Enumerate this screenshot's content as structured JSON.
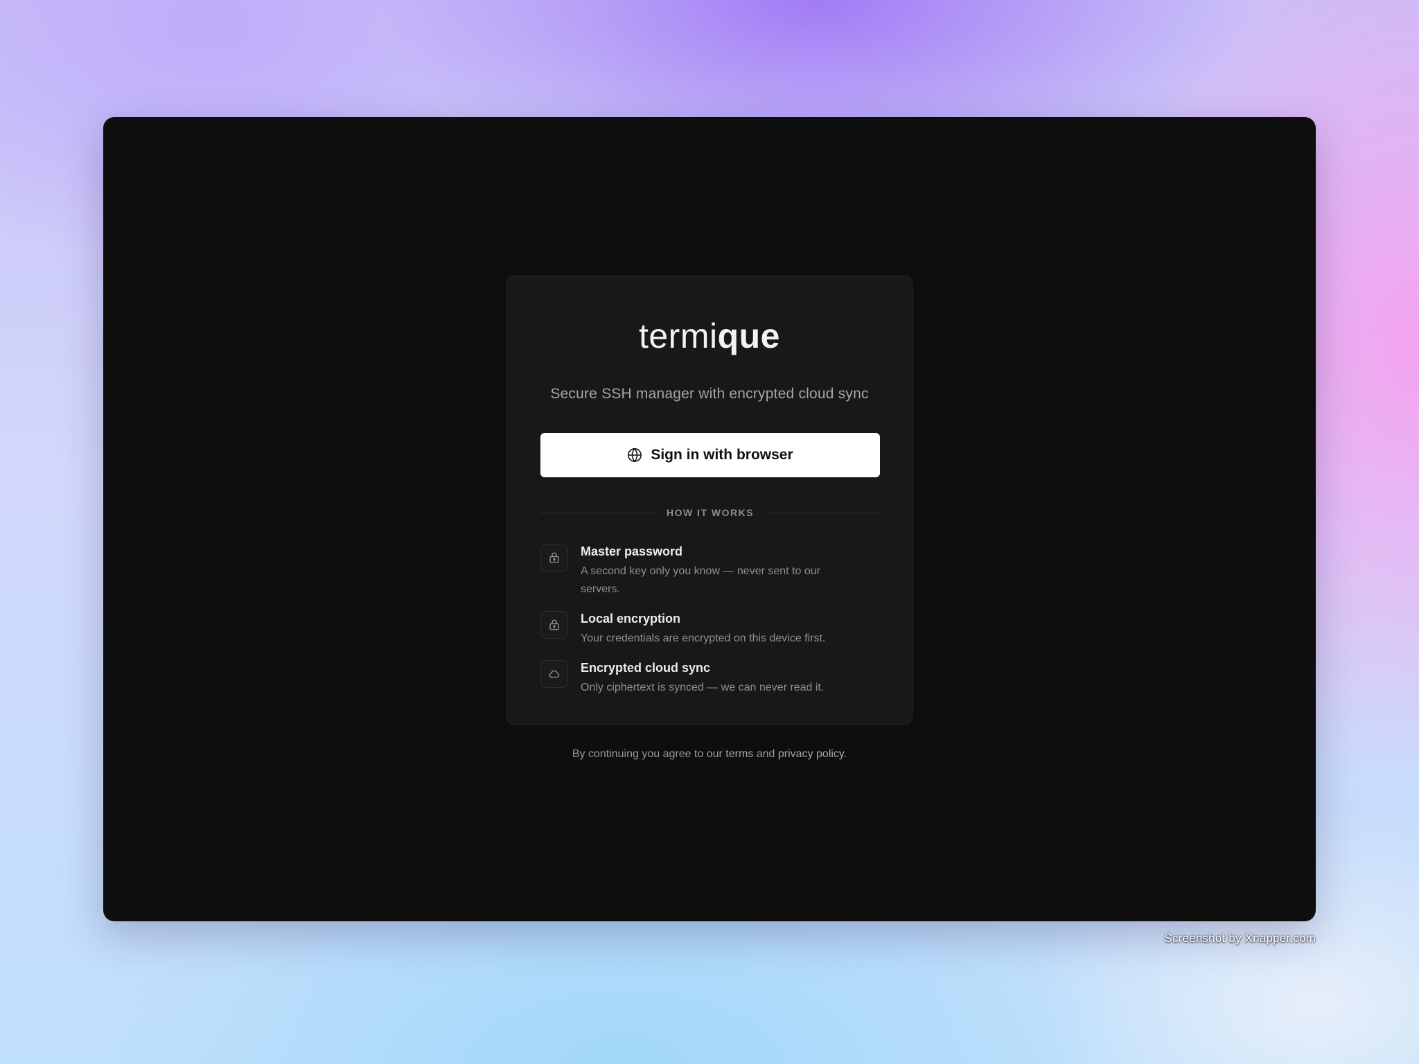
{
  "app": {
    "logo_light": "termi",
    "logo_bold": "que",
    "tagline": "Secure SSH manager with encrypted cloud sync"
  },
  "signin_button": {
    "label": "Sign in with browser",
    "icon": "globe-icon"
  },
  "how_it_works": {
    "heading": "HOW IT WORKS",
    "features": [
      {
        "icon": "lock-icon",
        "title": "Master password",
        "description": "A second key only you know — never sent to our servers."
      },
      {
        "icon": "lock-icon",
        "title": "Local encryption",
        "description": "Your credentials are encrypted on this device first."
      },
      {
        "icon": "cloud-icon",
        "title": "Encrypted cloud sync",
        "description": "Only ciphertext is synced — we can never read it."
      }
    ]
  },
  "footer": {
    "prefix": "By continuing you agree to our ",
    "terms": "terms",
    "and": " and ",
    "privacy": "privacy policy",
    "suffix": "."
  },
  "watermark": "Screenshot by Xnapper.com",
  "colors": {
    "window_bg": "#0e0e0e",
    "card_bg": "#181818",
    "button_bg": "#ffffff",
    "text_primary": "#ececec",
    "text_muted": "#8f8f8f"
  }
}
